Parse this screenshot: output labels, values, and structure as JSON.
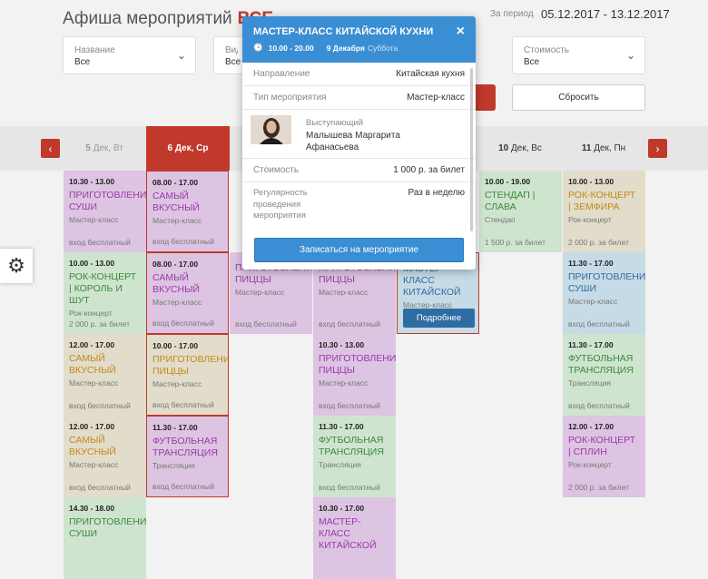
{
  "header": {
    "title": "Афиша мероприятий",
    "title_accent": "ВСЕ",
    "period_label": "За период",
    "period_value": "05.12.2017 - 13.12.2017"
  },
  "filters": [
    {
      "label": "Название",
      "value": "Все"
    },
    {
      "label": "Вид",
      "value": "Все"
    },
    {
      "label": "Стоимость",
      "value": "Все"
    }
  ],
  "reset_button": "Сбросить",
  "days": [
    {
      "num": "5",
      "label": "Дек, Вт"
    },
    {
      "num": "6",
      "label": "Дек, Ср"
    },
    {
      "num": "10",
      "label": "Дек, Вс"
    },
    {
      "num": "11",
      "label": "Дек, Пн"
    }
  ],
  "nav": {
    "prev": "‹",
    "next": "›"
  },
  "columns": [
    {
      "cards": [
        {
          "time": "10.30 - 13.00",
          "title": "ПРИГОТОВЛЕНИЕ СУШИ",
          "type": "Мастер-класс",
          "price": "вход бесплатный",
          "bg": "#ddc4e2",
          "tc": "#9b3aa8"
        },
        {
          "time": "10.00 - 13.00",
          "title": "РОК-КОНЦЕРТ | КОРОЛЬ И ШУТ",
          "type": "Рок-концерт",
          "price": "2 000 р. за билет",
          "bg": "#cfe4cf",
          "tc": "#3a8a3a"
        },
        {
          "time": "12.00 - 17.00",
          "title": "САМЫЙ ВКУСНЫЙ",
          "type": "Мастер-класс",
          "price": "вход бесплатный",
          "bg": "#e2dccb",
          "tc": "#c28a1a"
        },
        {
          "time": "12.00 - 17.00",
          "title": "САМЫЙ ВКУСНЫЙ",
          "type": "Мастер-класс",
          "price": "вход бесплатный",
          "bg": "#e2dccb",
          "tc": "#c28a1a"
        },
        {
          "time": "14.30 - 18.00",
          "title": "ПРИГОТОВЛЕНИЕ СУШИ",
          "type": "",
          "price": "",
          "bg": "#cfe4cf",
          "tc": "#3a8a3a"
        }
      ]
    },
    {
      "cards": [
        {
          "time": "08.00 - 17.00",
          "title": "САМЫЙ ВКУСНЫЙ",
          "type": "Мастер-класс",
          "price": "вход бесплатный",
          "bg": "#ddc4e2",
          "tc": "#9b3aa8"
        },
        {
          "time": "08.00 - 17.00",
          "title": "САМЫЙ ВКУСНЫЙ",
          "type": "Мастер-класс",
          "price": "вход бесплатный",
          "bg": "#ddc4e2",
          "tc": "#9b3aa8"
        },
        {
          "time": "10.00 - 17.00",
          "title": "ПРИГОТОВЛЕНИЕ ПИЦЦЫ",
          "type": "Мастер-класс",
          "price": "вход бесплатный",
          "bg": "#e2dccb",
          "tc": "#c28a1a"
        },
        {
          "time": "11.30 - 17.00",
          "title": "ФУТБОЛЬНАЯ ТРАНСЛЯЦИЯ",
          "type": "Трансляция",
          "price": "вход бесплатный",
          "bg": "#ddc4e2",
          "tc": "#9b3aa8"
        }
      ]
    },
    {
      "cards": [
        {
          "time": "",
          "title": "",
          "type": "",
          "price": "",
          "bg": "#f2f2f2",
          "tc": "#333"
        },
        {
          "time": "",
          "title": "ПРИГОТОВЛЕНИЕ ПИЦЦЫ",
          "type": "Мастер-класс",
          "price": "вход бесплатный",
          "bg": "#ddc4e2",
          "tc": "#9b3aa8"
        }
      ]
    },
    {
      "cards": [
        {
          "time": "",
          "title": "",
          "type": "",
          "price": "",
          "bg": "#f2f2f2",
          "tc": "#333"
        },
        {
          "time": "",
          "title": "ПРИГОТОВЛЕНИЕ ПИЦЦЫ",
          "type": "Мастер-класс",
          "price": "вход бесплатный",
          "bg": "#ddc4e2",
          "tc": "#9b3aa8"
        },
        {
          "time": "10.30 - 13.00",
          "title": "ПРИГОТОВЛЕНИЕ ПИЦЦЫ",
          "type": "Мастер-класс",
          "price": "вход бесплатный",
          "bg": "#ddc4e2",
          "tc": "#9b3aa8"
        },
        {
          "time": "11.30 - 17.00",
          "title": "ФУТБОЛЬНАЯ ТРАНСЛЯЦИЯ",
          "type": "Трансляция",
          "price": "вход бесплатный",
          "bg": "#cfe4cf",
          "tc": "#3a8a3a"
        },
        {
          "time": "10.30 - 17.00",
          "title": "МАСТЕР-КЛАСС КИТАЙСКОЙ",
          "type": "",
          "price": "",
          "bg": "#ddc4e2",
          "tc": "#9b3aa8"
        }
      ]
    },
    {
      "cards": [
        {
          "time": "",
          "title": "",
          "type": "",
          "price": "",
          "bg": "#f2f2f2",
          "tc": "#333"
        },
        {
          "time": "",
          "title": "МАСТЕР-КЛАСС КИТАЙСКОЙ",
          "type": "Мастер-класс",
          "price": "",
          "bg": "#c7dbe6",
          "tc": "#2d6da3",
          "button": "Подробнее",
          "selected": true
        }
      ]
    },
    {
      "cards": [
        {
          "time": "10.00 - 19.00",
          "title": "СТЕНДАП | СЛАВА",
          "type": "Стендап",
          "price": "1 500 р. за билет",
          "bg": "#cfe4cf",
          "tc": "#3a8a3a"
        }
      ]
    },
    {
      "cards": [
        {
          "time": "10.00 - 13.00",
          "title": "РОК-КОНЦЕРТ | ЗЕМФИРА",
          "type": "Рок-концерт",
          "price": "2 000 р. за билет",
          "bg": "#e2dccb",
          "tc": "#c28a1a"
        },
        {
          "time": "11.30 - 17.00",
          "title": "ПРИГОТОВЛЕНИЕ СУШИ",
          "type": "Мастер-класс",
          "price": "вход бесплатный",
          "bg": "#c7dbe6",
          "tc": "#2d6da3"
        },
        {
          "time": "11.30 - 17.00",
          "title": "ФУТБОЛЬНАЯ ТРАНСЛЯЦИЯ",
          "type": "Трансляция",
          "price": "вход бесплатный",
          "bg": "#cfe4cf",
          "tc": "#3a8a3a"
        },
        {
          "time": "12.00 - 17.00",
          "title": "РОК-КОНЦЕРТ | СПЛИН",
          "type": "Рок-концерт",
          "price": "2 000 р. за билет",
          "bg": "#ddc4e2",
          "tc": "#9b3aa8"
        }
      ]
    }
  ],
  "popup": {
    "title": "МАСТЕР-КЛАСС КИТАЙСКОЙ КУХНИ",
    "time": "10.00 - 20.00",
    "date": "9 Декабря",
    "weekday": "Суббота",
    "direction_label": "Направление",
    "direction_value": "Китайская кухня",
    "type_label": "Тип мероприятия",
    "type_value": "Мастер-класс",
    "performer_label": "Выступающий",
    "performer_name": "Малышева Маргарита Афанасьева",
    "cost_label": "Стоимость",
    "cost_value": "1 000 р. за билет",
    "regularity_label": "Регулярность проведения мероприятия",
    "regularity_value": "Раз в неделю",
    "register_button": "Записаться на мероприятие",
    "close": "×"
  },
  "colors": {
    "accent": "#c0392b",
    "popup_blue": "#3a8ed4"
  }
}
